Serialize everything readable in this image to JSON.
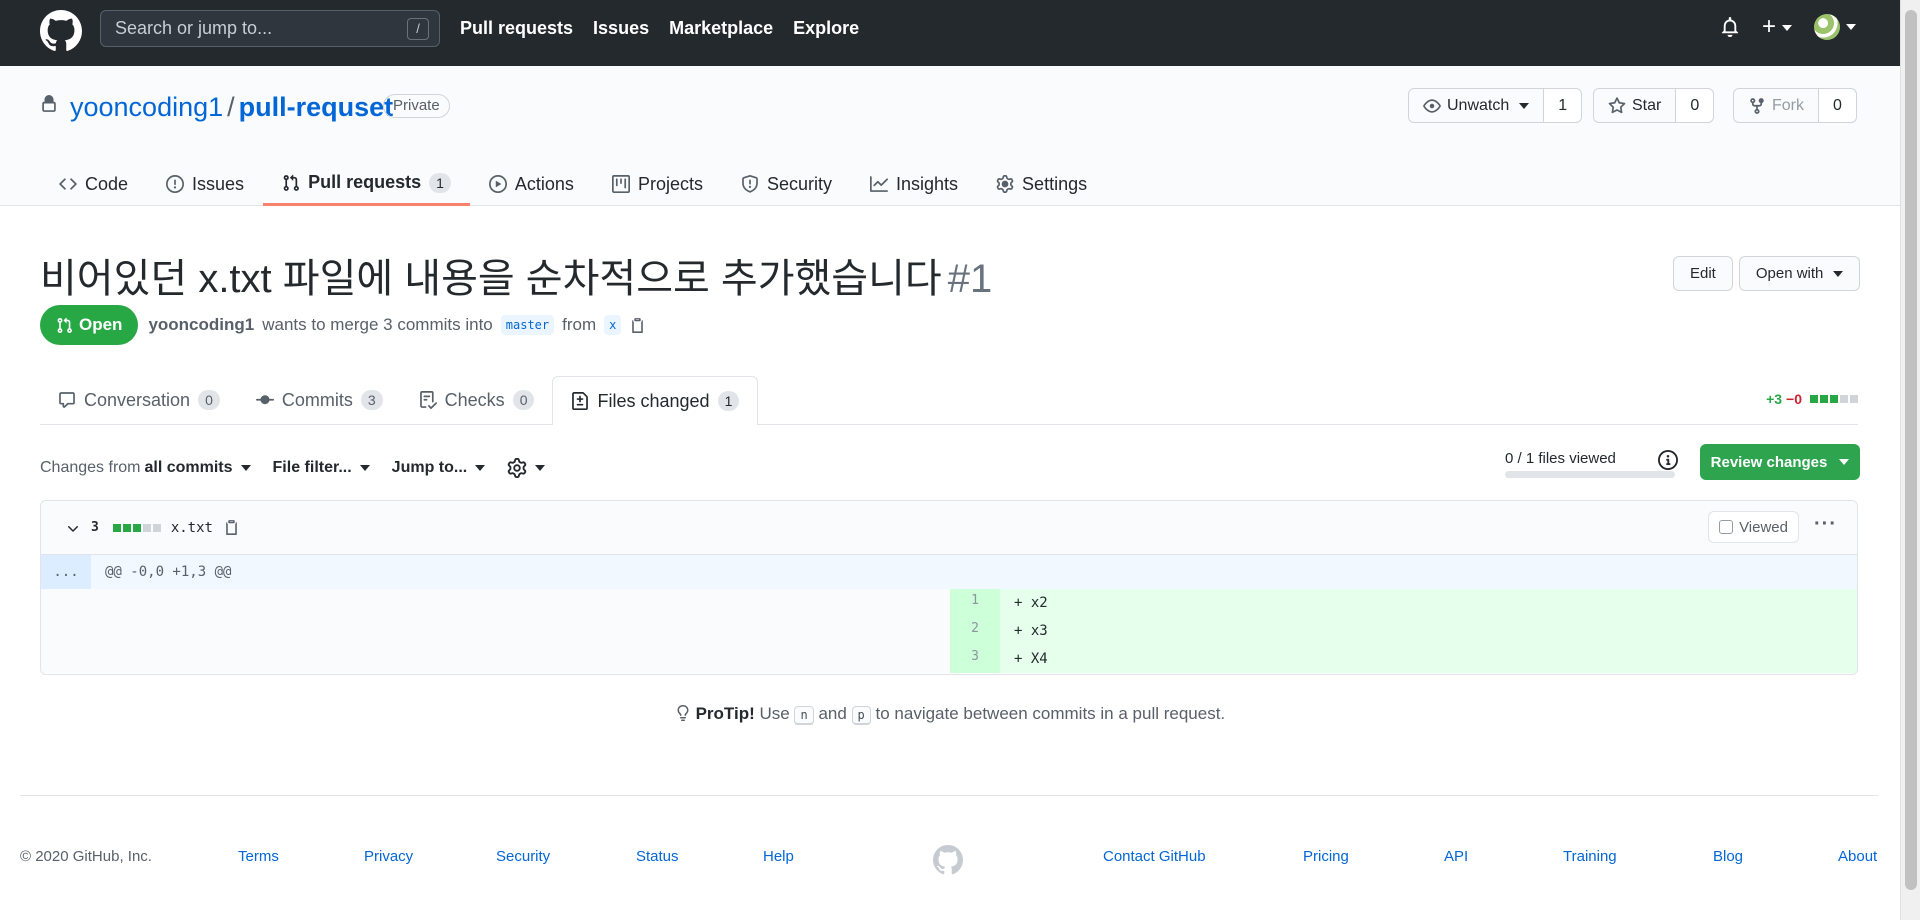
{
  "header": {
    "search_placeholder": "Search or jump to...",
    "search_shortcut": "/",
    "nav": [
      "Pull requests",
      "Issues",
      "Marketplace",
      "Explore"
    ]
  },
  "repo": {
    "owner": "yooncoding1",
    "separator": "/",
    "name": "pull-requset",
    "visibility": "Private",
    "unwatch_label": "Unwatch",
    "watch_count": "1",
    "star_label": "Star",
    "star_count": "0",
    "fork_label": "Fork",
    "fork_count": "0",
    "tabs": [
      {
        "label": "Code",
        "icon": "code-icon"
      },
      {
        "label": "Issues",
        "icon": "issue-icon"
      },
      {
        "label": "Pull requests",
        "icon": "pull-request-icon",
        "counter": "1"
      },
      {
        "label": "Actions",
        "icon": "play-icon"
      },
      {
        "label": "Projects",
        "icon": "project-icon"
      },
      {
        "label": "Security",
        "icon": "shield-icon"
      },
      {
        "label": "Insights",
        "icon": "graph-icon"
      },
      {
        "label": "Settings",
        "icon": "gear-icon"
      }
    ]
  },
  "pr": {
    "title": "비어있던 x.txt 파일에 내용을 순차적으로 추가했습니다",
    "number": "#1",
    "edit_label": "Edit",
    "open_with_label": "Open with",
    "state": "Open",
    "author": "yooncoding1",
    "merge_text": "wants to merge 3 commits into",
    "base_branch": "master",
    "from_text": "from",
    "head_branch": "x",
    "tabs": [
      {
        "label": "Conversation",
        "counter": "0",
        "icon": "comment-icon"
      },
      {
        "label": "Commits",
        "counter": "3",
        "icon": "commit-icon"
      },
      {
        "label": "Checks",
        "counter": "0",
        "icon": "checklist-icon"
      },
      {
        "label": "Files changed",
        "counter": "1",
        "icon": "file-diff-icon"
      }
    ],
    "additions": "+3",
    "deletions": "−0"
  },
  "toolbar": {
    "changes_from_prefix": "Changes from",
    "changes_from_value": "all commits",
    "file_filter": "File filter...",
    "jump_to": "Jump to...",
    "files_viewed": "0 / 1 files viewed",
    "files_viewed_fraction": 0,
    "review_changes": "Review changes"
  },
  "file": {
    "change_count": "3",
    "name": "x.txt",
    "viewed_label": "Viewed",
    "hunk_expand": "...",
    "hunk_header": "@@ -0,0 +1,3 @@",
    "lines": [
      {
        "num": "1",
        "code": "+ x2"
      },
      {
        "num": "2",
        "code": "+ x3"
      },
      {
        "num": "3",
        "code": "+ X4"
      }
    ]
  },
  "protip": {
    "title": "ProTip!",
    "pre": "Use",
    "key1": "n",
    "mid": "and",
    "key2": "p",
    "post": "to navigate between commits in a pull request."
  },
  "footer": {
    "copyright": "© 2020 GitHub, Inc.",
    "links_left": [
      "Terms",
      "Privacy",
      "Security",
      "Status",
      "Help"
    ],
    "links_right": [
      "Contact GitHub",
      "Pricing",
      "API",
      "Training",
      "Blog",
      "About"
    ]
  },
  "colors": {
    "header_bg": "#24292e",
    "link": "#0366d6",
    "open_green": "#28a745",
    "review_green": "#2ea44f",
    "tab_accent": "#f9826c",
    "deletion_red": "#cb2431"
  }
}
